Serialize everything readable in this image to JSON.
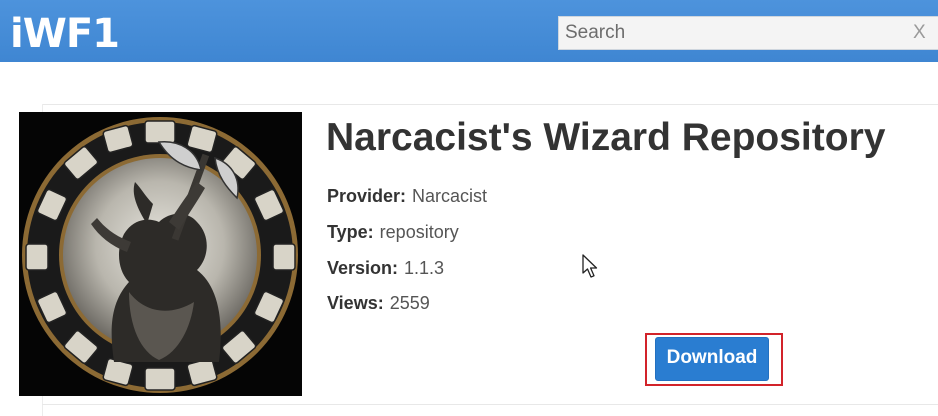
{
  "header": {
    "logo_text": "iWF1",
    "search": {
      "placeholder": "Search",
      "value": "",
      "clear_label": "X"
    },
    "color": "#4a90d9"
  },
  "addon": {
    "title": "Narcacist's Wizard Repository",
    "thumbnail_icon": "axe-warrior-emblem",
    "meta": [
      {
        "label": "Provider:",
        "value": "Narcacist"
      },
      {
        "label": "Type:",
        "value": "repository"
      },
      {
        "label": "Version:",
        "value": "1.1.3"
      },
      {
        "label": "Views:",
        "value": "2559"
      }
    ],
    "download_label": "Download",
    "download_color": "#2a7dd1",
    "highlight_color": "#d2232a"
  }
}
